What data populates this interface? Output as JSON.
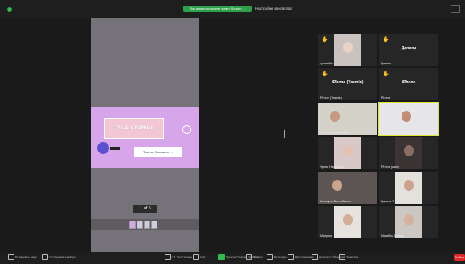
{
  "topbar": {
    "share_banner": "Вы демонстрируете экран: Screen ...",
    "view_options": "Настройки просмотра"
  },
  "slide": {
    "title": "TRUE STORIES",
    "text_box": "Тексты: Запишите ...",
    "page_indicator": "1 of 5"
  },
  "gallery": [
    {
      "id": "a",
      "label": "русскийм...",
      "big": "",
      "hand": true,
      "photo": "girl-hair"
    },
    {
      "id": "b",
      "label": "Данияр",
      "big": "Данияр",
      "hand": true,
      "photo": ""
    },
    {
      "id": "c",
      "label": "iPhone (Yasmin)",
      "big": "iPhone (Yasmin)",
      "hand": true,
      "photo": ""
    },
    {
      "id": "d",
      "label": "iPhone",
      "big": "iPhone",
      "hand": true,
      "photo": ""
    },
    {
      "id": "e",
      "label": "Гульнар Оразалиева",
      "big": "",
      "hand": false,
      "photo": "woman-glasses"
    },
    {
      "id": "f",
      "label": "Мухтарова Алтынай",
      "big": "",
      "hand": false,
      "photo": "woman-dark",
      "highlight": true
    },
    {
      "id": "g",
      "label": "Ирина Назарова",
      "big": "",
      "hand": false,
      "photo": "girl-pink"
    },
    {
      "id": "h",
      "label": "iPhone (user)",
      "big": "",
      "hand": false,
      "photo": "dark-room"
    },
    {
      "id": "i",
      "label": "Асемгуль Балтабаева",
      "big": "",
      "hand": false,
      "photo": "woman-room"
    },
    {
      "id": "j",
      "label": "Дарина Т.",
      "big": "",
      "hand": false,
      "photo": "girl-window"
    },
    {
      "id": "k",
      "label": "Айгерим",
      "big": "",
      "hand": false,
      "photo": "woman-light"
    },
    {
      "id": "l",
      "label": "Айнабек Динара",
      "big": "",
      "hand": false,
      "photo": "girl-face"
    }
  ],
  "toolbar": {
    "mute": "Включить звук",
    "video": "Остановить видео",
    "participants": "Участники",
    "participants_count": "21",
    "chat": "Чат",
    "share": "Демонстрация экрана",
    "record": "Запись",
    "reactions": "Реакции",
    "apps": "Приложения",
    "whiteboard": "Доска сообщений",
    "notes": "Заметки",
    "end": "Выйти"
  },
  "colors": {
    "accent_green": "#2da14a",
    "slide_purple": "#d7a6ea",
    "highlight": "#d9e82e",
    "end_red": "#e02828"
  }
}
